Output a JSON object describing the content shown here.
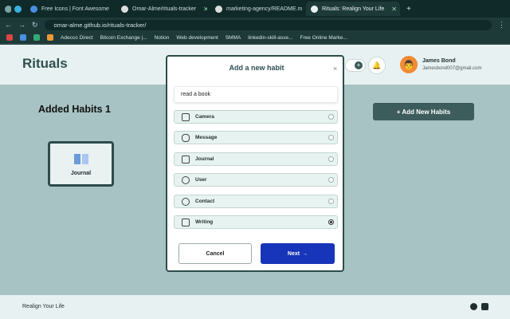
{
  "browser": {
    "tabs": [
      {
        "label": "Free Icons | Font Awesome"
      },
      {
        "label": "Omar-Alme/rituals-tracker"
      },
      {
        "label": "marketing-agency/README.m"
      },
      {
        "label": "Rituals: Realign Your Life"
      }
    ],
    "url": "omar-alme.github.io/rituals-tracker/",
    "bookmarks": [
      "Adecco Direct",
      "Bitcoin Exchange |...",
      "Notion",
      "Web development",
      "SMMA",
      "linkedin-skill-asse...",
      "Free Online Marke..."
    ]
  },
  "app": {
    "logo": "Rituals",
    "user": {
      "name": "James Bond",
      "email": "Jamesbond007@gmail.com"
    },
    "added_title": "Added Habits 1",
    "habit_card": {
      "label": "Journal"
    },
    "add_button": "+ Add New Habits",
    "footer": "Realign Your Life"
  },
  "modal": {
    "title": "Add a new habit",
    "close": "×",
    "input_value": "read a book",
    "options": [
      {
        "label": "Camera",
        "icon": "camera-icon",
        "selected": false
      },
      {
        "label": "Message",
        "icon": "message-icon",
        "selected": false
      },
      {
        "label": "Journal",
        "icon": "book-icon",
        "selected": false
      },
      {
        "label": "User",
        "icon": "user-icon",
        "selected": false
      },
      {
        "label": "Contact",
        "icon": "phone-icon",
        "selected": false
      },
      {
        "label": "Writing",
        "icon": "writing-icon",
        "selected": true
      }
    ],
    "cancel_label": "Cancel",
    "next_label": "Next",
    "next_arrow": "→"
  }
}
